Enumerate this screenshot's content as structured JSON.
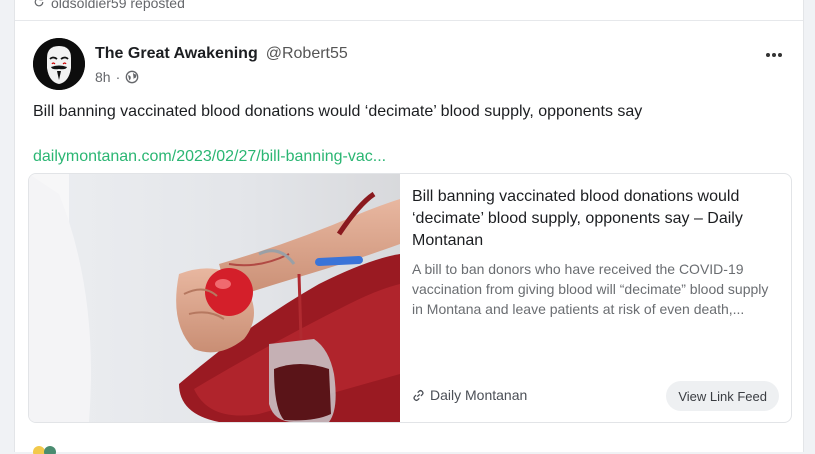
{
  "repost": {
    "text": "oldsoldier59 reposted",
    "icon": "repost-icon"
  },
  "post": {
    "author_name": "The Great Awakening",
    "author_handle": "@Robert55",
    "time": "8h",
    "dot": "·",
    "visibility_icon": "globe-icon",
    "more_icon": "more-horizontal-icon",
    "text": "Bill banning vaccinated blood donations would ‘decimate’ blood supply, opponents say",
    "link_text": "dailymontanan.com/2023/02/27/bill-banning-vac..."
  },
  "link_card": {
    "image_icon": "blood-donation-photo",
    "title": "Bill banning vaccinated blood donations would ‘decimate’ blood supply, opponents say – Daily Montanan",
    "description": "A bill to ban donors who have received the COVID-19 vaccination from giving blood will “decimate” blood supply in Montana and leave patients at risk of even death,...",
    "source": "Daily Montanan",
    "source_icon": "link-icon",
    "button_label": "View Link Feed"
  },
  "colors": {
    "link": "#2bb673",
    "text": "#1c1e21",
    "muted": "#65676b"
  }
}
